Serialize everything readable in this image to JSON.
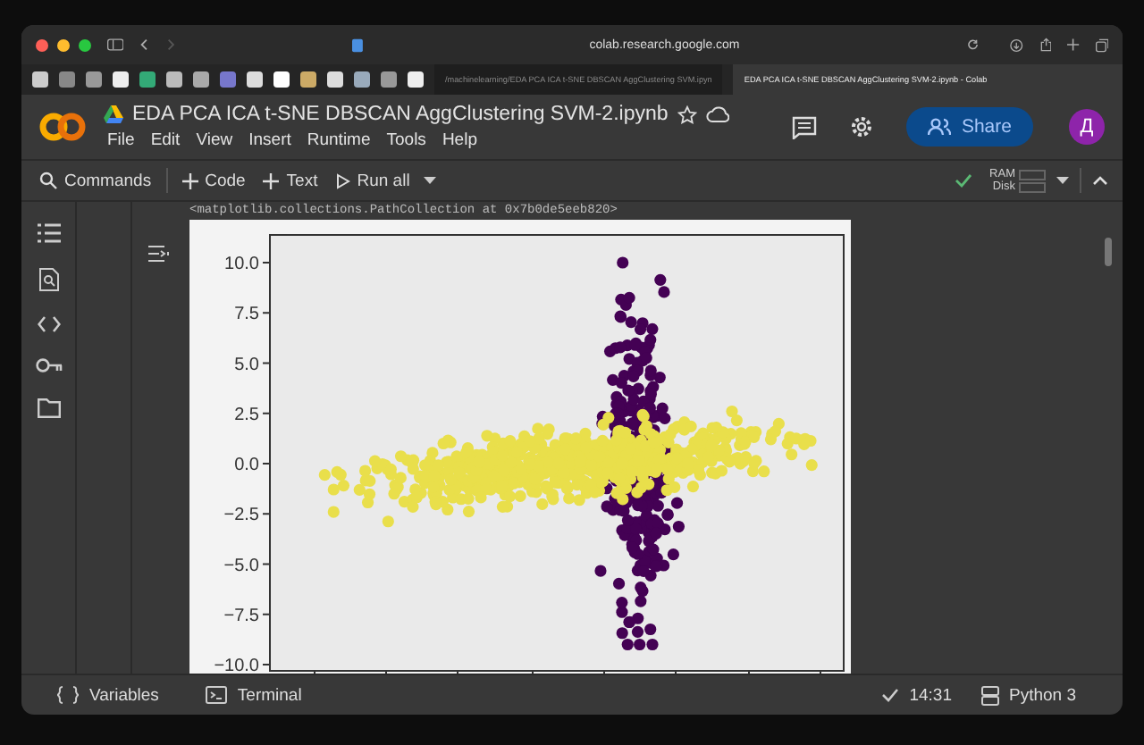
{
  "browser": {
    "address": "colab.research.google.com",
    "tabs": [
      {
        "label": "/machinelearning/EDA PCA ICA t-SNE DBSCAN AggClustering SVM.ipyn",
        "selected": false
      },
      {
        "label": "EDA PCA ICA t-SNE DBSCAN AggClustering SVM-2.ipynb - Colab",
        "selected": true
      }
    ]
  },
  "notebook": {
    "title": "EDA PCA ICA t-SNE DBSCAN AggClustering SVM-2.ipynb",
    "menu": [
      "File",
      "Edit",
      "View",
      "Insert",
      "Runtime",
      "Tools",
      "Help"
    ],
    "share": "Share",
    "avatar": "Д"
  },
  "toolbar": {
    "buttons": [
      {
        "kind": "search",
        "label": "Commands"
      },
      {
        "kind": "add",
        "label": "Code"
      },
      {
        "kind": "add",
        "label": "Text"
      },
      {
        "kind": "run",
        "label": "Run all"
      }
    ],
    "ram": "RAM",
    "disk": "Disk"
  },
  "output": {
    "text": "<matplotlib.collections.PathCollection at 0x7b0de5eeb820>",
    "y_tick_labels": [
      "10.0",
      "7.5",
      "5.0",
      "2.5",
      "0.0",
      "−2.5",
      "−5.0",
      "−7.5",
      "−10.0"
    ]
  },
  "status_bar": {
    "items": [
      {
        "kind": "variables",
        "label": "Variables"
      },
      {
        "kind": "terminal",
        "label": "Terminal"
      }
    ],
    "time": "14:31",
    "runtime": "Python 3"
  }
}
